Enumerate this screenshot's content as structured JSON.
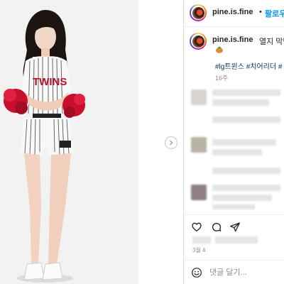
{
  "post": {
    "username": "pine.is.fine",
    "follow_separator": "•",
    "follow_label": "팔로우",
    "caption_text": "열지 막냉이",
    "caption_emoji": "pine-icon",
    "hashtags": "#lg트윈스 #치어리더 #",
    "time_ago": "16주",
    "date": "3월 4"
  },
  "media": {
    "jersey_text": "TWINS",
    "next_icon": "chevron-right-icon"
  },
  "comment": {
    "placeholder": "댓글 달기..."
  },
  "icons": {
    "like": "heart-icon",
    "comment": "comment-icon",
    "share": "share-icon",
    "emoji": "emoji-icon"
  },
  "colors": {
    "accent": "#0095f6",
    "hashtag": "#00376b",
    "muted": "#8e8e8e",
    "text": "#262626"
  }
}
